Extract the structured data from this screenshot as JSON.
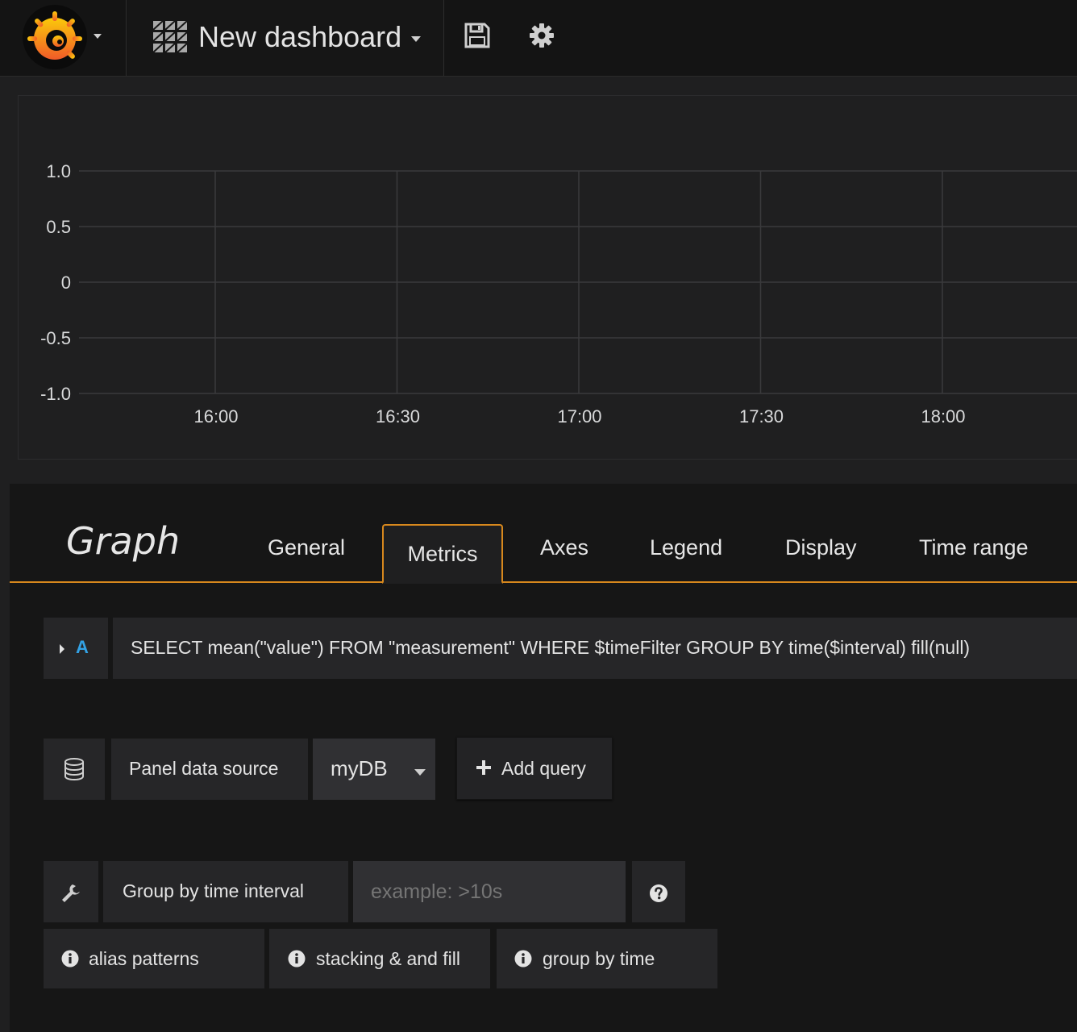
{
  "topnav": {
    "dashboard_title": "New dashboard"
  },
  "chart_data": {
    "type": "line",
    "x": [
      "16:00",
      "16:30",
      "17:00",
      "17:30",
      "18:00"
    ],
    "ylim": [
      -1.0,
      1.0
    ],
    "yticks": [
      "1.0",
      "0.5",
      "0",
      "-0.5",
      "-1.0"
    ],
    "xticks": [
      "16:00",
      "16:30",
      "17:00",
      "17:30",
      "18:00"
    ],
    "grid": true,
    "series": []
  },
  "editor": {
    "title": "Graph",
    "tabs": [
      {
        "label": "General"
      },
      {
        "label": "Metrics"
      },
      {
        "label": "Axes"
      },
      {
        "label": "Legend"
      },
      {
        "label": "Display"
      },
      {
        "label": "Time range"
      }
    ],
    "active_tab": "Metrics",
    "query": {
      "ref_id": "A",
      "text": "SELECT mean(\"value\") FROM \"measurement\" WHERE $timeFilter GROUP BY time($interval) fill(null)"
    },
    "datasource": {
      "label": "Panel data source",
      "selected": "myDB",
      "add_query_label": "Add query"
    },
    "interval": {
      "label": "Group by time interval",
      "placeholder": "example: >10s",
      "value": ""
    },
    "help_buttons": [
      {
        "label": "alias patterns"
      },
      {
        "label": "stacking & and fill"
      },
      {
        "label": "group by time"
      }
    ]
  },
  "colors": {
    "accent": "#d7881d",
    "query_ref": "#33a2e5",
    "background": "#1f1f20"
  }
}
